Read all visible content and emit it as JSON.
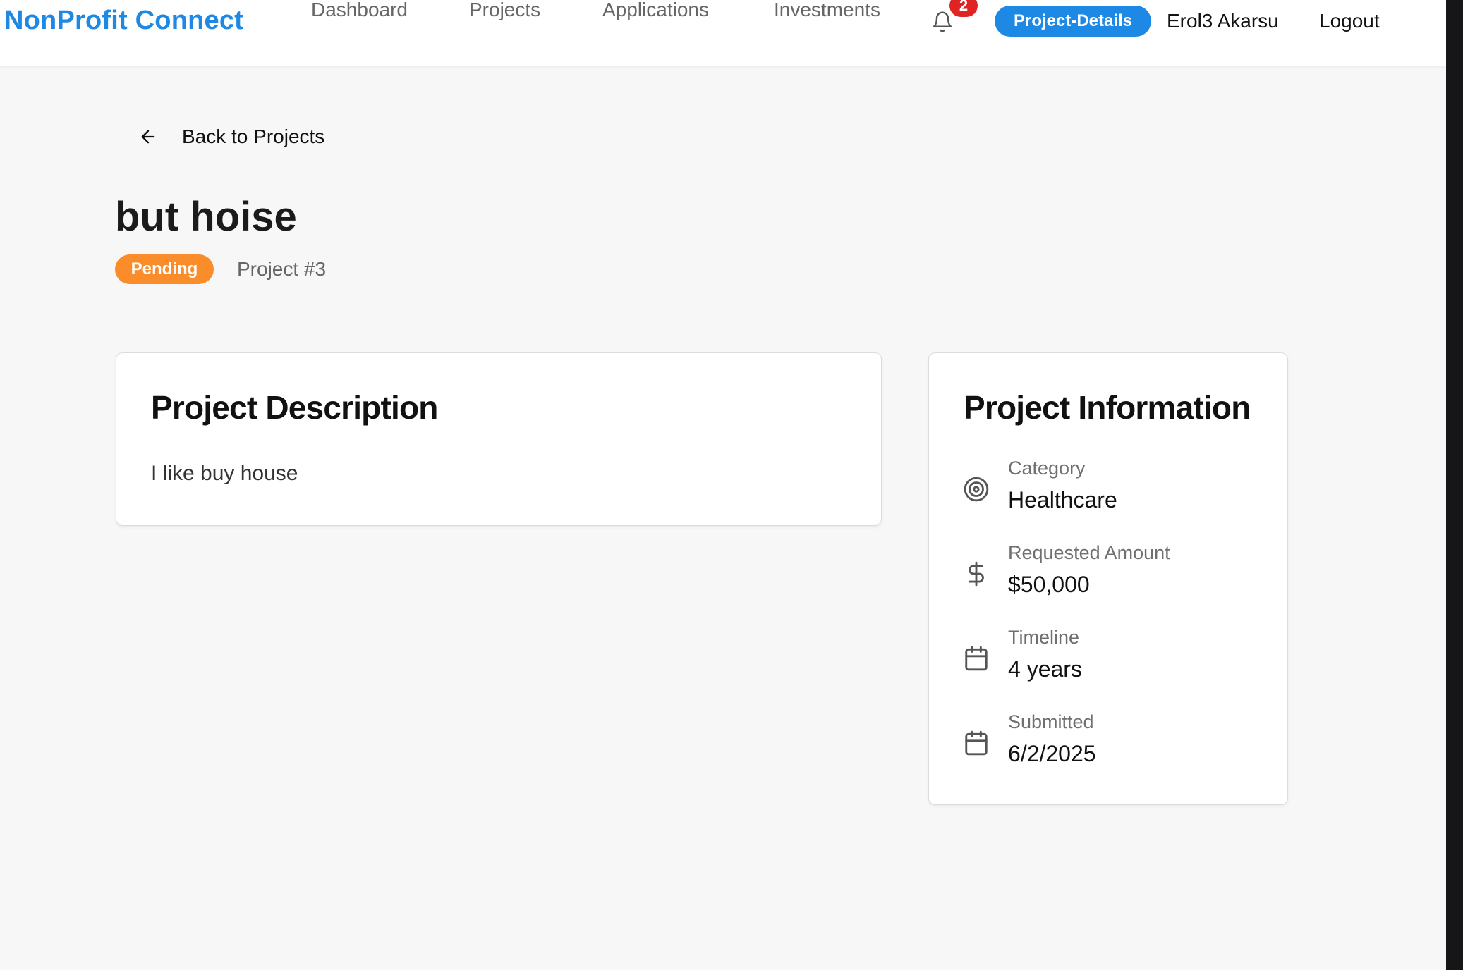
{
  "header": {
    "brand": "NonProfit Connect",
    "nav": {
      "dashboard": "Dashboard",
      "projects": "Projects",
      "applications": "Applications",
      "investments": "Investments"
    },
    "notification_count": "2",
    "current_page_pill": "Project-Details",
    "user_name": "Erol3 Akarsu",
    "logout": "Logout"
  },
  "back_link": "Back to Projects",
  "project": {
    "title": "but hoise",
    "status": "Pending",
    "number": "Project #3"
  },
  "description_card": {
    "heading": "Project Description",
    "text": "I like buy house"
  },
  "info_card": {
    "heading": "Project Information",
    "rows": [
      {
        "label": "Category",
        "value": "Healthcare",
        "icon": "target-icon"
      },
      {
        "label": "Requested Amount",
        "value": "$50,000",
        "icon": "dollar-icon"
      },
      {
        "label": "Timeline",
        "value": "4 years",
        "icon": "calendar-icon"
      },
      {
        "label": "Submitted",
        "value": "6/2/2025",
        "icon": "calendar-icon"
      }
    ]
  },
  "colors": {
    "brand": "#1e88e5",
    "pending": "#fb8c2a",
    "notification": "#e02424",
    "background": "#f7f7f7"
  }
}
